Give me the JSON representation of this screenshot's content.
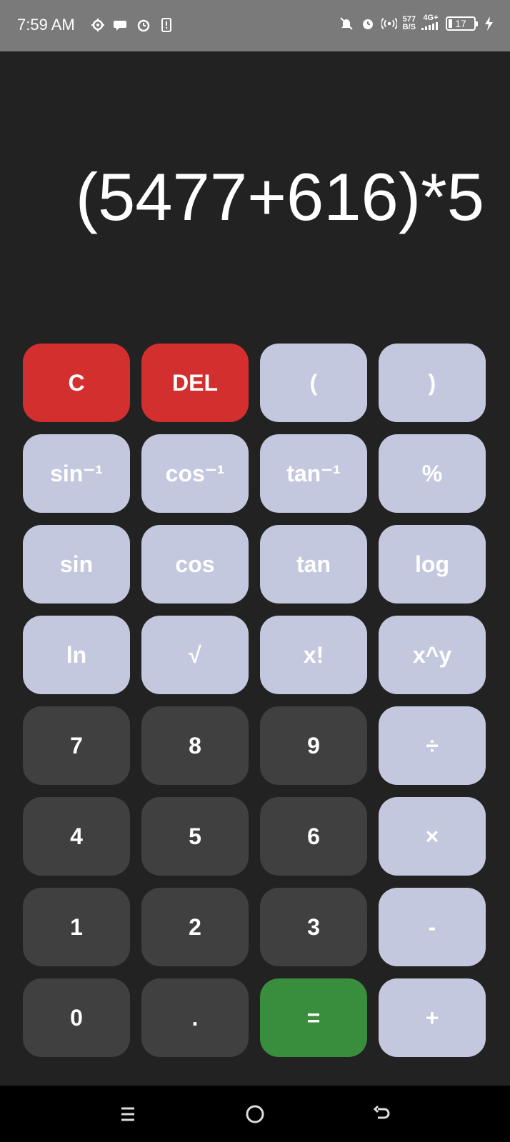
{
  "status_bar": {
    "time": "7:59 AM",
    "net_speed_value": "577",
    "net_speed_unit": "B/S",
    "network_type": "4G+",
    "battery": "17",
    "left_icons": [
      "settings-gear-icon",
      "chat-bubble-icon",
      "alarm-icon",
      "phone-alert-icon"
    ],
    "right_icons": [
      "bell-off-icon",
      "alarm-icon",
      "hotspot-icon",
      "signal-icon",
      "battery-icon",
      "charging-bolt-icon"
    ]
  },
  "display": {
    "expression": "(5477+616)*5"
  },
  "keypad": {
    "rows": [
      [
        {
          "label": "C",
          "style": "danger",
          "name": "clear-button"
        },
        {
          "label": "DEL",
          "style": "danger",
          "name": "delete-button"
        },
        {
          "label": "(",
          "style": "fn",
          "name": "open-paren-button"
        },
        {
          "label": ")",
          "style": "fn",
          "name": "close-paren-button"
        }
      ],
      [
        {
          "label": "sin⁻¹",
          "style": "fn",
          "name": "arcsin-button"
        },
        {
          "label": "cos⁻¹",
          "style": "fn",
          "name": "arccos-button"
        },
        {
          "label": "tan⁻¹",
          "style": "fn",
          "name": "arctan-button"
        },
        {
          "label": "%",
          "style": "fn",
          "name": "percent-button"
        }
      ],
      [
        {
          "label": "sin",
          "style": "fn",
          "name": "sin-button"
        },
        {
          "label": "cos",
          "style": "fn",
          "name": "cos-button"
        },
        {
          "label": "tan",
          "style": "fn",
          "name": "tan-button"
        },
        {
          "label": "log",
          "style": "fn",
          "name": "log-button"
        }
      ],
      [
        {
          "label": "ln",
          "style": "fn",
          "name": "ln-button"
        },
        {
          "label": "√",
          "style": "fn",
          "name": "sqrt-button"
        },
        {
          "label": "x!",
          "style": "fn",
          "name": "factorial-button"
        },
        {
          "label": "x^y",
          "style": "fn",
          "name": "power-button"
        }
      ],
      [
        {
          "label": "7",
          "style": "num",
          "name": "digit-7-button"
        },
        {
          "label": "8",
          "style": "num",
          "name": "digit-8-button"
        },
        {
          "label": "9",
          "style": "num",
          "name": "digit-9-button"
        },
        {
          "label": "÷",
          "style": "fn",
          "name": "divide-button"
        }
      ],
      [
        {
          "label": "4",
          "style": "num",
          "name": "digit-4-button"
        },
        {
          "label": "5",
          "style": "num",
          "name": "digit-5-button"
        },
        {
          "label": "6",
          "style": "num",
          "name": "digit-6-button"
        },
        {
          "label": "×",
          "style": "fn",
          "name": "multiply-button"
        }
      ],
      [
        {
          "label": "1",
          "style": "num",
          "name": "digit-1-button"
        },
        {
          "label": "2",
          "style": "num",
          "name": "digit-2-button"
        },
        {
          "label": "3",
          "style": "num",
          "name": "digit-3-button"
        },
        {
          "label": "-",
          "style": "fn",
          "name": "subtract-button"
        }
      ],
      [
        {
          "label": "0",
          "style": "num",
          "name": "digit-0-button"
        },
        {
          "label": ".",
          "style": "num",
          "name": "decimal-button"
        },
        {
          "label": "=",
          "style": "equals",
          "name": "equals-button"
        },
        {
          "label": "+",
          "style": "fn",
          "name": "add-button"
        }
      ]
    ]
  },
  "colors": {
    "background": "#222222",
    "function_key": "#c3c8de",
    "number_key": "#404040",
    "danger_key": "#d32f2f",
    "equals_key": "#388e3c",
    "status_bar": "#7a7a7a",
    "nav_bar": "#000000"
  },
  "nav_bar": {
    "icons": [
      "recents-icon",
      "home-icon",
      "back-icon"
    ]
  }
}
